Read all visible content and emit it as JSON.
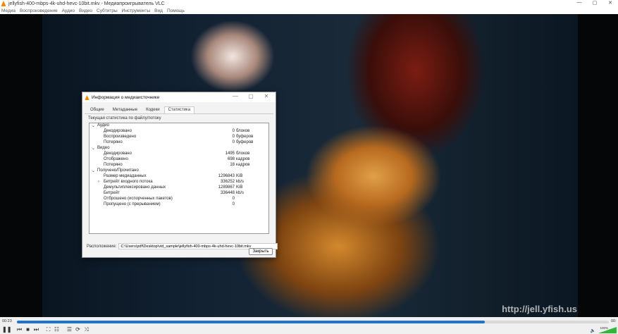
{
  "window": {
    "title": "jellyfish-400-mbps-4k-uhd-hevc-10bit.mkv - Медиапроигрыватель VLC",
    "min": "—",
    "max": "▢",
    "close": "✕"
  },
  "menu": [
    "Медиа",
    "Воспроизведение",
    "Аудио",
    "Видео",
    "Субтитры",
    "Инструменты",
    "Вид",
    "Помощь"
  ],
  "video": {
    "watermark": "http://jell.yfish.us"
  },
  "dialog": {
    "title": "Информация о медиаисточнике",
    "tabs": [
      "Общие",
      "Метаданные",
      "Кодеки",
      "Статистика"
    ],
    "caption": "Текущая статистика по файлу/потоку",
    "groups": [
      {
        "name": "Аудио",
        "rows": [
          {
            "label": "Декодировано",
            "value": "0",
            "unit": "блоков"
          },
          {
            "label": "Воспроизведено",
            "value": "0",
            "unit": "буферов"
          },
          {
            "label": "Потеряно",
            "value": "0",
            "unit": "буферов"
          }
        ]
      },
      {
        "name": "Видео",
        "rows": [
          {
            "label": "Декодировано",
            "value": "1495",
            "unit": "блоков"
          },
          {
            "label": "Отображено",
            "value": "698",
            "unit": "кадров"
          },
          {
            "label": "Потеряно",
            "value": "18",
            "unit": "кадров"
          }
        ]
      },
      {
        "name": "Получено/Прочитано",
        "rows": [
          {
            "label": "Размер медиаданных",
            "value": "1296843",
            "unit": "KiB"
          },
          {
            "label": "Битрейт входного потока",
            "value": "336252",
            "unit": "kb/s",
            "expandable": true
          },
          {
            "label": "Демультиплексировано данных",
            "value": "1289867",
            "unit": "KiB"
          },
          {
            "label": "Битрейт",
            "value": "336448",
            "unit": "kb/s"
          },
          {
            "label": "Отброшено (испорченных пакетов)",
            "value": "0",
            "unit": ""
          },
          {
            "label": "Пропущено (с прерыванием)",
            "value": "0",
            "unit": ""
          }
        ]
      }
    ],
    "location_label": "Расположение:",
    "location_value": "C:\\Users\\pdf\\Desktop\\vid_sample\\jellyfish-400-mbps-4k-uhd-hevc-10bit.mkv",
    "close_label": "Закрыть"
  },
  "player": {
    "elapsed": "00:23",
    "remaining": "00:",
    "progress": 0.79,
    "volume_label": "100%",
    "volume": 1.0
  }
}
